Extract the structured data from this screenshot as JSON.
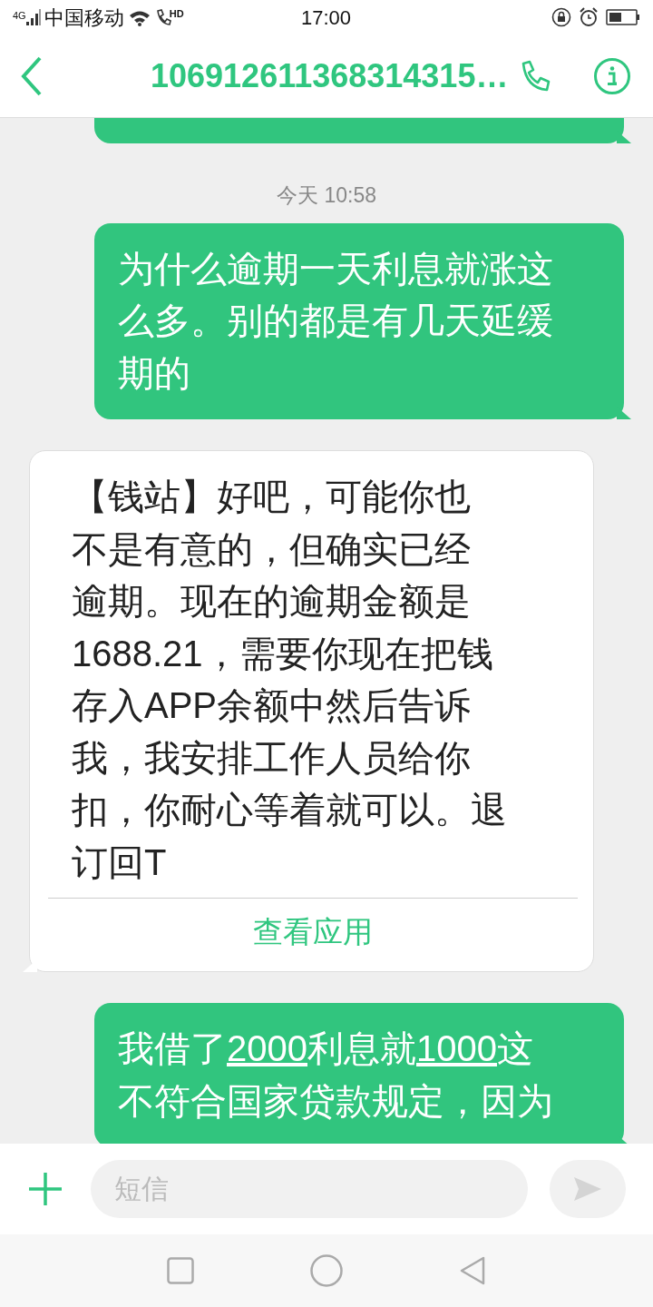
{
  "status_bar": {
    "network": "4G",
    "carrier": "中国移动",
    "call_badge": "HD",
    "time": "17:00"
  },
  "header": {
    "title": "106912611368314315…"
  },
  "messages": [
    {
      "kind": "outgoing"
    },
    {
      "kind": "timestamp",
      "text": "今天 10:58"
    },
    {
      "kind": "outgoing",
      "lines": [
        [
          {
            "text": "为什么逾期一天利息就涨这",
            "link": false
          }
        ],
        [
          {
            "text": "么多。别的都是有几天延缓",
            "link": false
          }
        ],
        [
          {
            "text": "期的",
            "link": false
          }
        ]
      ]
    },
    {
      "kind": "incoming",
      "lines": [
        "【钱站】好吧，可能你也",
        "不是有意的，但确实已经",
        "逾期。现在的逾期金额是",
        "1688.21，需要你现在把钱",
        "存入APP余额中然后告诉",
        "我，我安排工作人员给你",
        "扣，你耐心等着就可以。退",
        "订回T"
      ],
      "action": "查看应用"
    },
    {
      "kind": "outgoing",
      "lines": [
        [
          {
            "text": "我借了",
            "link": false
          },
          {
            "text": "2000",
            "link": true
          },
          {
            "text": "利息就",
            "link": false
          },
          {
            "text": "1000",
            "link": true
          },
          {
            "text": "这",
            "link": false
          }
        ],
        [
          {
            "text": "不符合国家贷款规定，因为",
            "link": false
          }
        ]
      ]
    }
  ],
  "composer": {
    "placeholder": "短信"
  }
}
